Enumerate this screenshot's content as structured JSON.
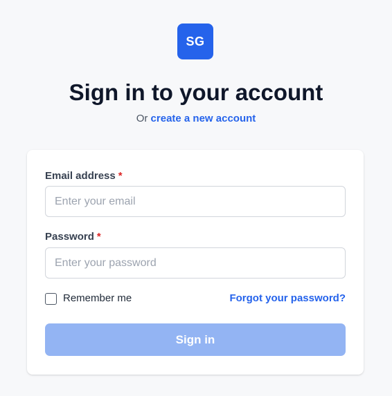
{
  "logo": {
    "text": "SG",
    "color": "#2563eb"
  },
  "header": {
    "title": "Sign in to your account",
    "subtitle_prefix": "Or",
    "create_account_link": "create a new account"
  },
  "form": {
    "email": {
      "label": "Email address",
      "required_mark": "*",
      "placeholder": "Enter your email",
      "value": ""
    },
    "password": {
      "label": "Password",
      "required_mark": "*",
      "placeholder": "Enter your password",
      "value": ""
    },
    "remember_me": {
      "label": "Remember me",
      "checked": false
    },
    "forgot_password_link": "Forgot your password?",
    "submit": {
      "label": "Sign in",
      "disabled": true
    }
  },
  "colors": {
    "accent": "#2563eb",
    "button_disabled": "#93b4f3",
    "required": "#dc2626",
    "background": "#f7f8fa"
  }
}
